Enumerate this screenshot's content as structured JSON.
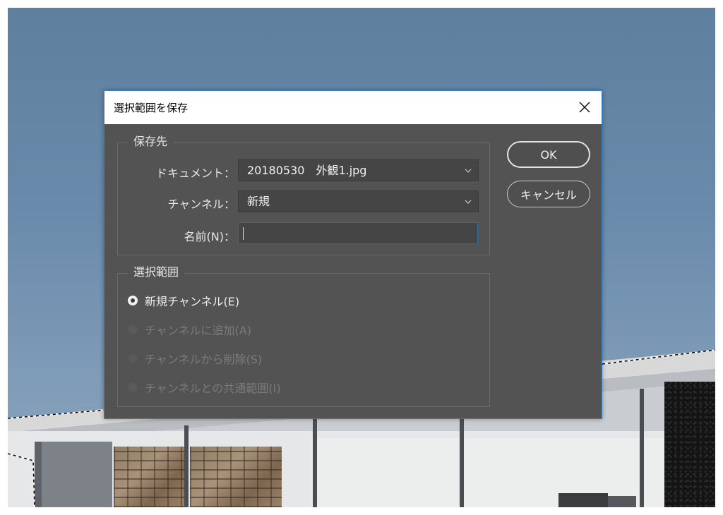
{
  "dialog": {
    "title": "選択範囲を保存",
    "close_icon": "close-icon"
  },
  "destination": {
    "group_label": "保存先",
    "document_label": "ドキュメント：",
    "document_value": "20180530　外観1.jpg",
    "channel_label": "チャンネル：",
    "channel_value": "新規",
    "name_label": "名前(N)：",
    "name_value": ""
  },
  "operation": {
    "group_label": "選択範囲",
    "options": [
      {
        "label": "新規チャンネル(E)",
        "selected": true,
        "enabled": true
      },
      {
        "label": "チャンネルに追加(A)",
        "selected": false,
        "enabled": false
      },
      {
        "label": "チャンネルから削除(S)",
        "selected": false,
        "enabled": false
      },
      {
        "label": "チャンネルとの共通範囲(I)",
        "selected": false,
        "enabled": false
      }
    ]
  },
  "buttons": {
    "ok": "OK",
    "cancel": "キャンセル"
  },
  "colors": {
    "dialog_bg": "#535353",
    "accent_border": "#3c7fc2",
    "sky": "#6a8aab"
  }
}
